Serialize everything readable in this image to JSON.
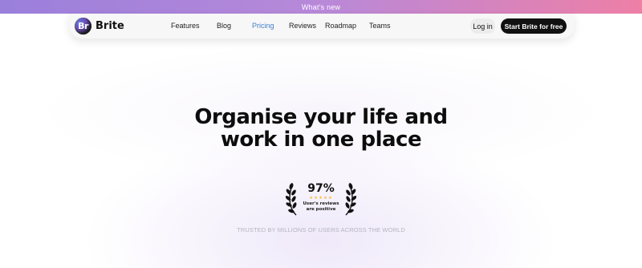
{
  "announcement": {
    "text": "What's new"
  },
  "brand": {
    "logo_letters": "Br",
    "name": "Brite"
  },
  "nav": {
    "items": [
      {
        "label": "Features"
      },
      {
        "label": "Blog"
      },
      {
        "label": "Pricing",
        "active": true
      },
      {
        "label": "Reviews"
      },
      {
        "label": "Roadmap"
      },
      {
        "label": "Teams"
      }
    ],
    "login_label": "Log in",
    "cta_label": "Start Brite for free"
  },
  "hero": {
    "title_line1": "Organise your life and",
    "title_line2": "work in one place"
  },
  "badge": {
    "percent": "97%",
    "stars": "★★★★★",
    "line1": "User's reviews",
    "line2": "are positive"
  },
  "trusted_text": "TRUSTED BY MILLIONS OF USERS ACROSS THE WORLD",
  "colors": {
    "active_link": "#3b7fd6",
    "cta_bg": "#111111",
    "banner_start": "#9a7fdb",
    "banner_end": "#ee7fa6",
    "stars": "#f2c14a"
  }
}
